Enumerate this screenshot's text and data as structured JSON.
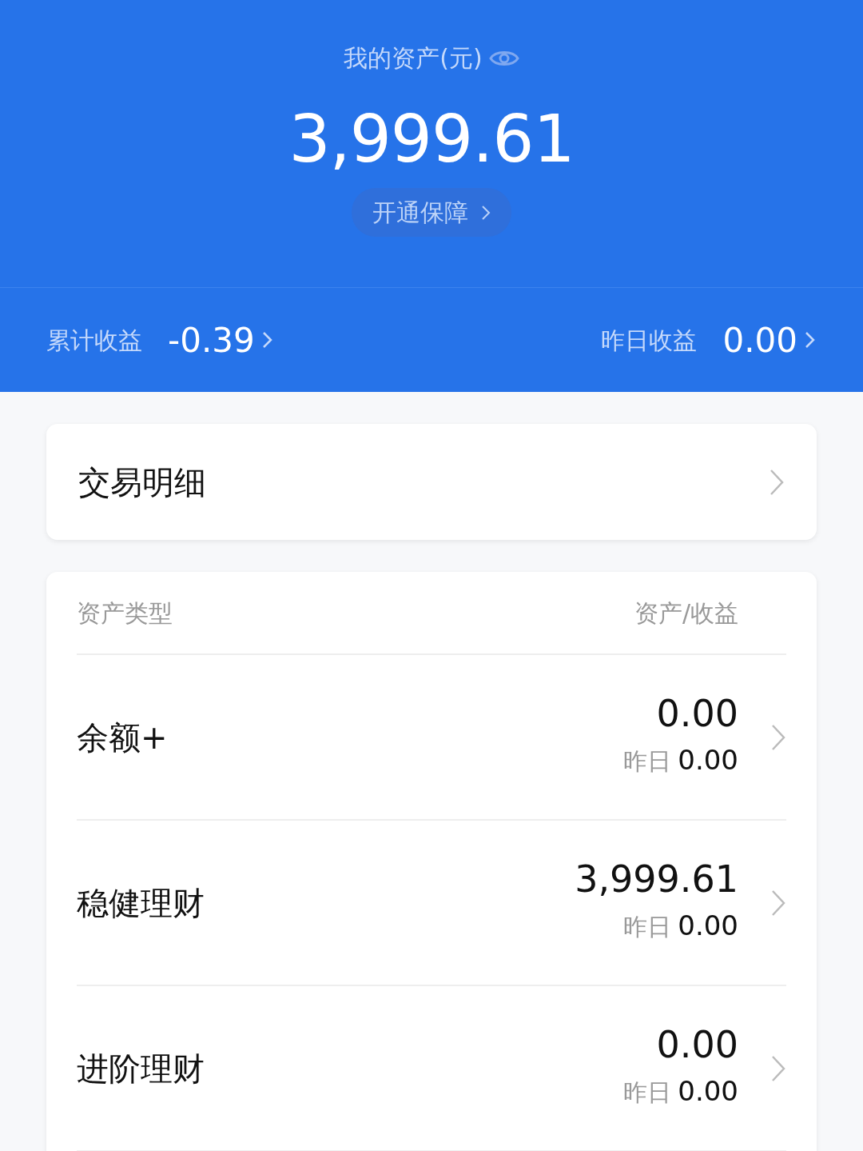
{
  "header": {
    "title": "我的资产(元)",
    "total": "3,999.61",
    "protect_button": "开通保障",
    "cumulative_label": "累计收益",
    "cumulative_value": "-0.39",
    "yesterday_label": "昨日收益",
    "yesterday_value": "0.00"
  },
  "transactions": {
    "label": "交易明细"
  },
  "assets": {
    "columns": [
      "资产类型",
      "资产/收益"
    ],
    "rows": [
      {
        "name": "余额+",
        "amount": "0.00",
        "yesterday_label": "昨日",
        "yesterday_value": "0.00"
      },
      {
        "name": "稳健理财",
        "amount": "3,999.61",
        "yesterday_label": "昨日",
        "yesterday_value": "0.00"
      },
      {
        "name": "进阶理财",
        "amount": "0.00",
        "yesterday_label": "昨日",
        "yesterday_value": "0.00"
      }
    ]
  }
}
